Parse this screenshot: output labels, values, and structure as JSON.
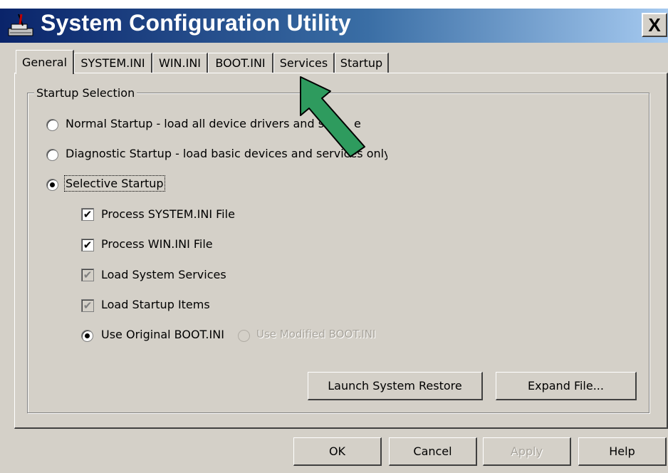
{
  "window": {
    "title": "System Configuration Utility",
    "close_glyph": "X",
    "app_icon": "system-config-icon"
  },
  "tabs": [
    {
      "label": "General",
      "active": true
    },
    {
      "label": "SYSTEM.INI",
      "active": false
    },
    {
      "label": "WIN.INI",
      "active": false
    },
    {
      "label": "BOOT.INI",
      "active": false
    },
    {
      "label": "Services",
      "active": false
    },
    {
      "label": "Startup",
      "active": false
    }
  ],
  "startup_selection": {
    "legend": "Startup Selection",
    "normal": {
      "label": "Normal Startup - load all device drivers and se",
      "tail": "e",
      "checked": false
    },
    "diagnostic": {
      "label": "Diagnostic Startup - load basic devices and services only",
      "checked": false
    },
    "selective": {
      "label": "Selective Startup",
      "checked": true
    },
    "options": [
      {
        "label": "Process SYSTEM.INI File",
        "checked": true,
        "enabled": true
      },
      {
        "label": "Process WIN.INI File",
        "checked": true,
        "enabled": true
      },
      {
        "label": "Load System Services",
        "checked": true,
        "enabled": false
      },
      {
        "label": "Load Startup Items",
        "checked": true,
        "enabled": false
      }
    ],
    "boot_original": {
      "label": "Use Original BOOT.INI",
      "checked": true
    },
    "boot_modified": {
      "label": "Use Modified BOOT.INI",
      "checked": false,
      "enabled": false
    }
  },
  "panel_buttons": {
    "restore": "Launch System Restore",
    "expand": "Expand File..."
  },
  "footer_buttons": {
    "ok": "OK",
    "cancel": "Cancel",
    "apply": "Apply",
    "help": "Help"
  },
  "annotation": {
    "icon": "green-pointer-arrow",
    "color": "#2e9b5e"
  },
  "colors": {
    "face": "#d4d0c8",
    "title_start": "#0a246a",
    "title_end": "#a6caf0"
  }
}
